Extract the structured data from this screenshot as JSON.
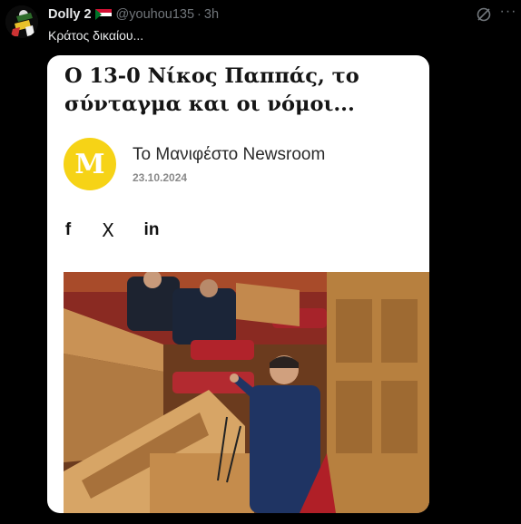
{
  "tweet": {
    "user_name": "Dolly 2",
    "handle": "@youhou135",
    "separator": "·",
    "time": "3h",
    "text": "Κράτος δικαίου...",
    "menu_glyph": "···"
  },
  "card": {
    "title": "Ο 13-0 Νίκος Παππάς, το σύνταγμα και οι νόμοι...",
    "logo_letter": "M",
    "author": "Το Μανιφέστο Newsroom",
    "date": "23.10.2024",
    "share": {
      "facebook": "f",
      "x": "X",
      "linkedin": "in"
    }
  },
  "colors": {
    "background": "#000000",
    "logo_yellow": "#f6d316",
    "muted_text": "#71767b"
  },
  "icons": [
    "avatar",
    "sudan-flag-icon",
    "grok-icon",
    "more-icon",
    "facebook-icon",
    "x-icon",
    "linkedin-icon"
  ]
}
